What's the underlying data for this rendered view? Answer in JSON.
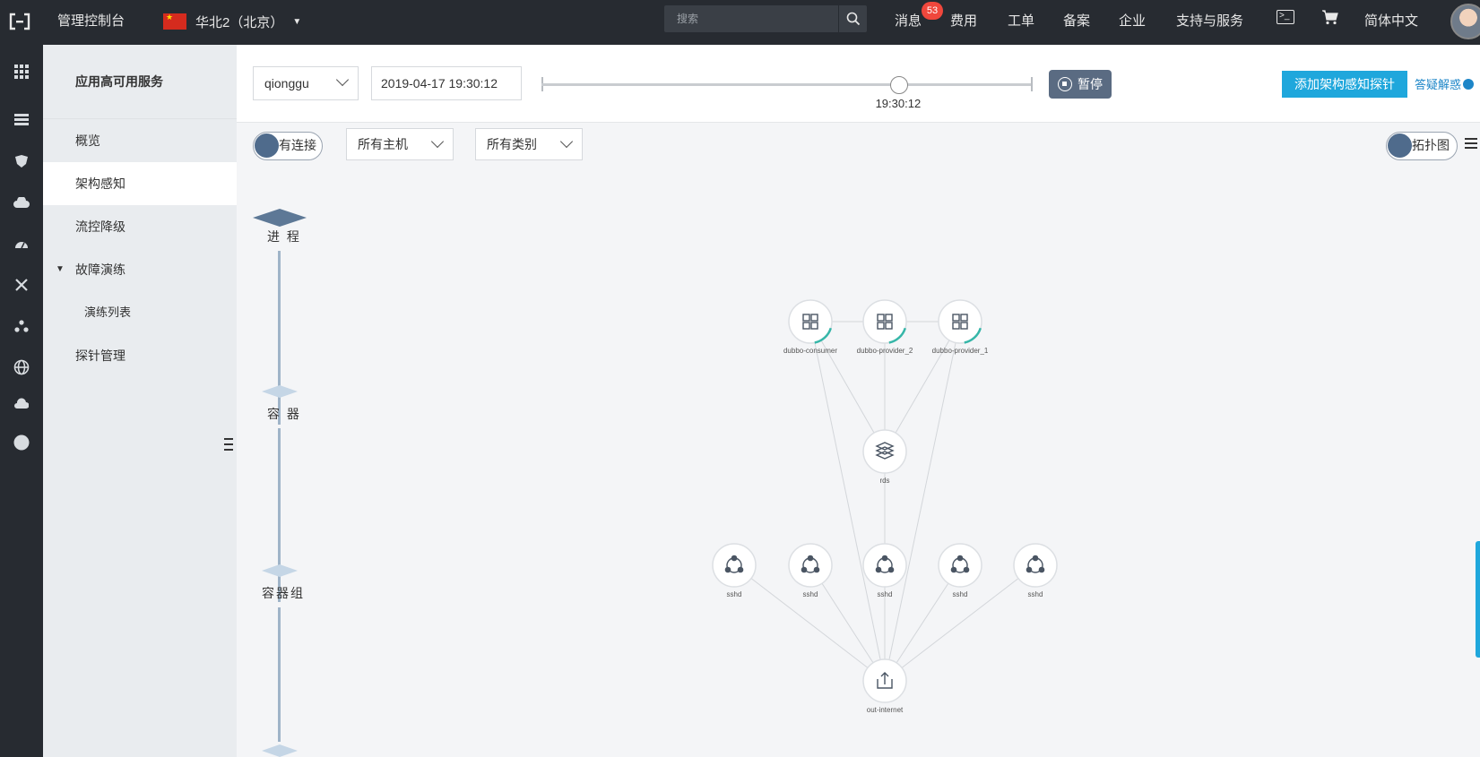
{
  "topbar": {
    "title": "管理控制台",
    "region": "华北2（北京）",
    "search_placeholder": "搜索",
    "nav": {
      "messages": "消息",
      "messages_badge": "53",
      "fees": "费用",
      "tickets": "工单",
      "icp": "备案",
      "enterprise": "企业",
      "support": "支持与服务",
      "language": "简体中文"
    }
  },
  "sidemenu": {
    "title": "应用高可用服务",
    "items": [
      {
        "label": "概览"
      },
      {
        "label": "架构感知"
      },
      {
        "label": "流控降级"
      },
      {
        "label": "故障演练"
      },
      {
        "label": "演练列表"
      },
      {
        "label": "探针管理"
      }
    ]
  },
  "toolbar": {
    "user_select": "qionggu",
    "datetime": "2019-04-17 19:30:12",
    "slider_time": "19:30:12",
    "slider_position": 0.73,
    "pause_label": "暂停",
    "add_probe_label": "添加架构感知探针",
    "faq_label": "答疑解惑"
  },
  "filters": {
    "connections_toggle": "有连接",
    "host_select": "所有主机",
    "type_select": "所有类别",
    "topology_toggle": "拓扑图"
  },
  "layers": [
    "进 程",
    "容 器",
    "容器组"
  ],
  "graph": {
    "nodes": [
      {
        "id": "n1",
        "label": "dubbo-consumer",
        "icon": "apps-icon"
      },
      {
        "id": "n2",
        "label": "dubbo-provider_2",
        "icon": "apps-icon"
      },
      {
        "id": "n3",
        "label": "dubbo-provider_1",
        "icon": "apps-icon"
      },
      {
        "id": "n4",
        "label": "rds",
        "icon": "database-icon"
      },
      {
        "id": "n5",
        "label": "sshd",
        "icon": "service-icon"
      },
      {
        "id": "n6",
        "label": "sshd",
        "icon": "service-icon"
      },
      {
        "id": "n7",
        "label": "sshd",
        "icon": "service-icon"
      },
      {
        "id": "n8",
        "label": "sshd",
        "icon": "service-icon"
      },
      {
        "id": "n9",
        "label": "sshd",
        "icon": "service-icon"
      },
      {
        "id": "n10",
        "label": "out-internet",
        "icon": "upload-icon"
      }
    ],
    "edges": [
      [
        "n1",
        "n2"
      ],
      [
        "n2",
        "n3"
      ],
      [
        "n1",
        "n4"
      ],
      [
        "n2",
        "n4"
      ],
      [
        "n3",
        "n4"
      ],
      [
        "n4",
        "n7"
      ],
      [
        "n1",
        "n10"
      ],
      [
        "n2",
        "n10"
      ],
      [
        "n3",
        "n10"
      ],
      [
        "n5",
        "n10"
      ],
      [
        "n6",
        "n10"
      ],
      [
        "n7",
        "n10"
      ],
      [
        "n8",
        "n10"
      ],
      [
        "n9",
        "n10"
      ]
    ]
  }
}
